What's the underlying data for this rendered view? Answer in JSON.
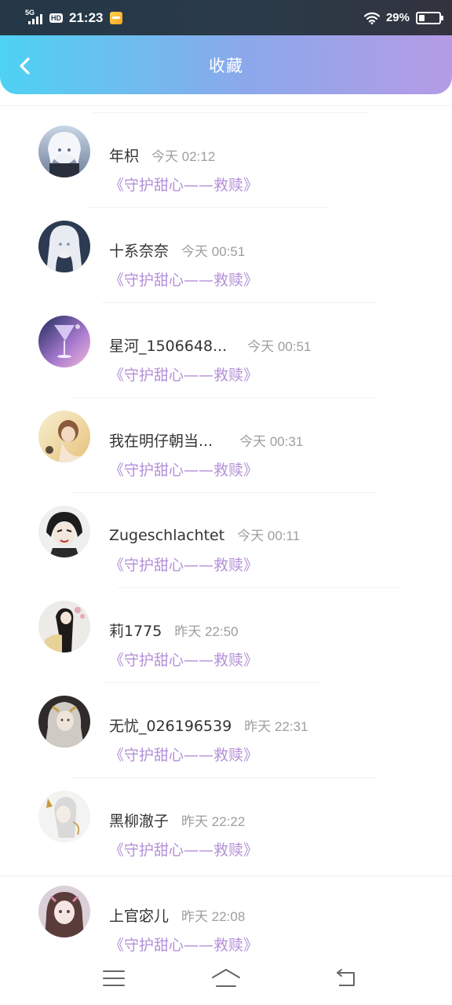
{
  "status_bar": {
    "network": "5G",
    "hd": "HD",
    "time": "21:23",
    "battery_percent": "29%",
    "battery_level": 0.29
  },
  "header": {
    "title": "收藏",
    "gradient_start": "#4ed2f4",
    "gradient_end": "#b59be6"
  },
  "items": [
    {
      "username": "年枳",
      "time": "今天 02:12",
      "title": "《守护甜心——救赎》"
    },
    {
      "username": "十系奈奈",
      "time": "今天 00:51",
      "title": "《守护甜心——救赎》"
    },
    {
      "username": "星河_1506648...",
      "time": "今天 00:51",
      "title": "《守护甜心——救赎》"
    },
    {
      "username": "我在明仔朝当...",
      "time": "今天 00:31",
      "title": "《守护甜心——救赎》"
    },
    {
      "username": "Zugeschlachtet",
      "time": "今天 00:11",
      "title": "《守护甜心——救赎》"
    },
    {
      "username": "莉1775",
      "time": "昨天 22:50",
      "title": "《守护甜心——救赎》"
    },
    {
      "username": "无忧_026196539",
      "time": "昨天 22:31",
      "title": "《守护甜心——救赎》"
    },
    {
      "username": "黑柳澈子",
      "time": "昨天 22:22",
      "title": "《守护甜心——救赎》"
    },
    {
      "username": "上官宓儿",
      "time": "昨天 22:08",
      "title": "《守护甜心——救赎》"
    }
  ],
  "colors": {
    "title_purple": "#b490d8",
    "time_gray": "#9e9e9e"
  },
  "nav": {
    "menu_icon": "menu-icon",
    "home_icon": "home-icon",
    "back_icon": "return-icon"
  }
}
